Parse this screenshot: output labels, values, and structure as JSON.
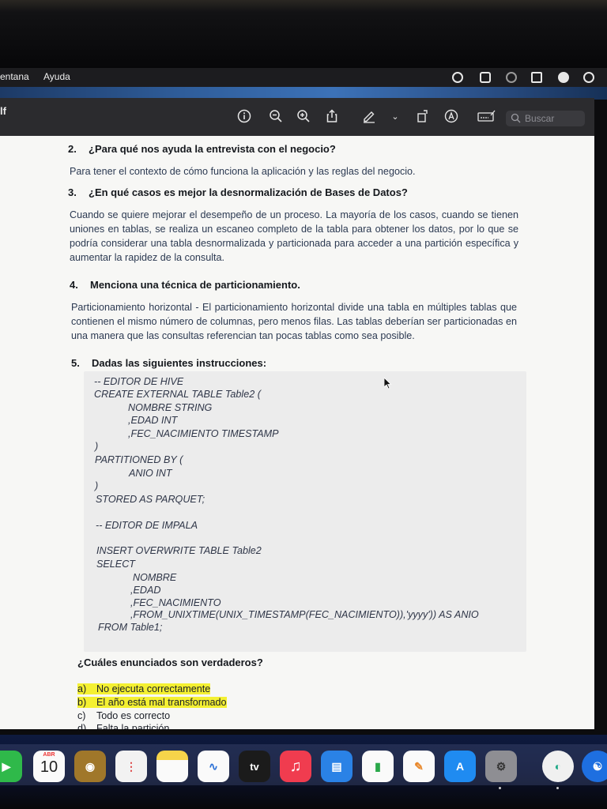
{
  "menubar": {
    "items": [
      "entana",
      "Ayuda"
    ]
  },
  "toolbar": {
    "window_title": "lf",
    "icons": [
      "info-icon",
      "zoom-out-icon",
      "zoom-in-icon",
      "share-icon",
      "markup-pen-icon",
      "chevron-down-icon",
      "rotate-icon",
      "annotate-icon",
      "form-fill-icon"
    ],
    "search": {
      "placeholder": "Buscar"
    }
  },
  "document": {
    "questions": [
      {
        "number": "2.",
        "text": "¿Para qué nos ayuda la entrevista con el negocio?",
        "answer": "Para tener el contexto de cómo funciona la aplicación y las reglas del negocio."
      },
      {
        "number": "3.",
        "text": "¿En qué casos es mejor la desnormalización de Bases de Datos?",
        "answer": "Cuando se quiere mejorar el desempeño de un proceso. La mayoría de los casos, cuando se tienen uniones en tablas, se realiza un escaneo completo de la tabla para obtener los datos, por lo que se podría considerar una tabla desnormalizada y particionada para acceder a una partición específica y aumentar la rapidez de la consulta."
      },
      {
        "number": "4.",
        "text": "Menciona una técnica de particionamiento.",
        "answer": "Particionamiento horizontal - El particionamiento horizontal divide una tabla en múltiples tablas que contienen el mismo número de columnas, pero menos filas. Las tablas deberían ser particionadas en una manera que las consultas referencian tan pocas tablas como sea posible."
      },
      {
        "number": "5.",
        "text": "Dadas las siguientes instrucciones:"
      }
    ],
    "code_lines": [
      "-- EDITOR DE HIVE",
      "CREATE EXTERNAL TABLE Table2 (",
      "NOMBRE STRING",
      ",EDAD INT",
      ",FEC_NACIMIENTO TIMESTAMP",
      ")",
      "PARTITIONED BY (",
      "ANIO INT",
      ")",
      "STORED AS PARQUET;",
      "-- EDITOR DE IMPALA",
      "INSERT OVERWRITE TABLE Table2",
      "SELECT",
      "NOMBRE",
      ",EDAD",
      ",FEC_NACIMIENTO",
      ",FROM_UNIXTIME(UNIX_TIMESTAMP(FEC_NACIMIENTO)),'yyyy')) AS ANIO",
      "FROM Table1;"
    ],
    "prompt": "¿Cuáles enunciados son verdaderos?",
    "options": [
      {
        "letter": "a)",
        "text": "No ejecuta correctamente",
        "highlighted": true
      },
      {
        "letter": "b)",
        "text": "El año está mal transformado",
        "highlighted": true
      },
      {
        "letter": "c)",
        "text": "Todo es correcto",
        "highlighted": false
      },
      {
        "letter": "d)",
        "text": "Falta la partición",
        "highlighted": false
      }
    ],
    "highlight_color": "#f4f032"
  },
  "dock": {
    "calendar": {
      "month": "ABR",
      "day": "10"
    },
    "apps": [
      "facetime",
      "contacts",
      "reminders",
      "notes",
      "freeform",
      "tv",
      "music",
      "keynote",
      "numbers",
      "pages",
      "app-store",
      "system-settings",
      "maps",
      "accessibility"
    ],
    "tv_label": "tv"
  }
}
